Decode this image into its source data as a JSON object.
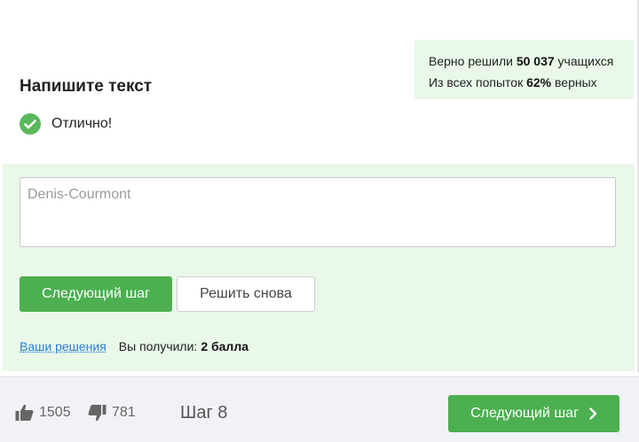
{
  "stats": {
    "solved_prefix": "Верно решили",
    "solved_count": "50 037",
    "solved_suffix": "учащихся",
    "attempts_prefix": "Из всех попыток",
    "attempts_percent": "62%",
    "attempts_suffix": "верных"
  },
  "task": {
    "title": "Напишите текст",
    "status": "Отлично!"
  },
  "answer": {
    "value": "Denis-Courmont"
  },
  "buttons": {
    "next_step": "Следующий шаг",
    "solve_again": "Решить снова"
  },
  "result": {
    "solutions_link": "Ваши решения",
    "received_label": "Вы получили:",
    "received_value": "2 балла"
  },
  "footer": {
    "likes": "1505",
    "dislikes": "781",
    "step_label": "Шаг 8",
    "next_step": "Следующий шаг"
  },
  "colors": {
    "accent": "#4caf50",
    "success_bg": "#e9f8e9",
    "link": "#2a7dd4",
    "footer_bg": "#f0f2f5"
  }
}
